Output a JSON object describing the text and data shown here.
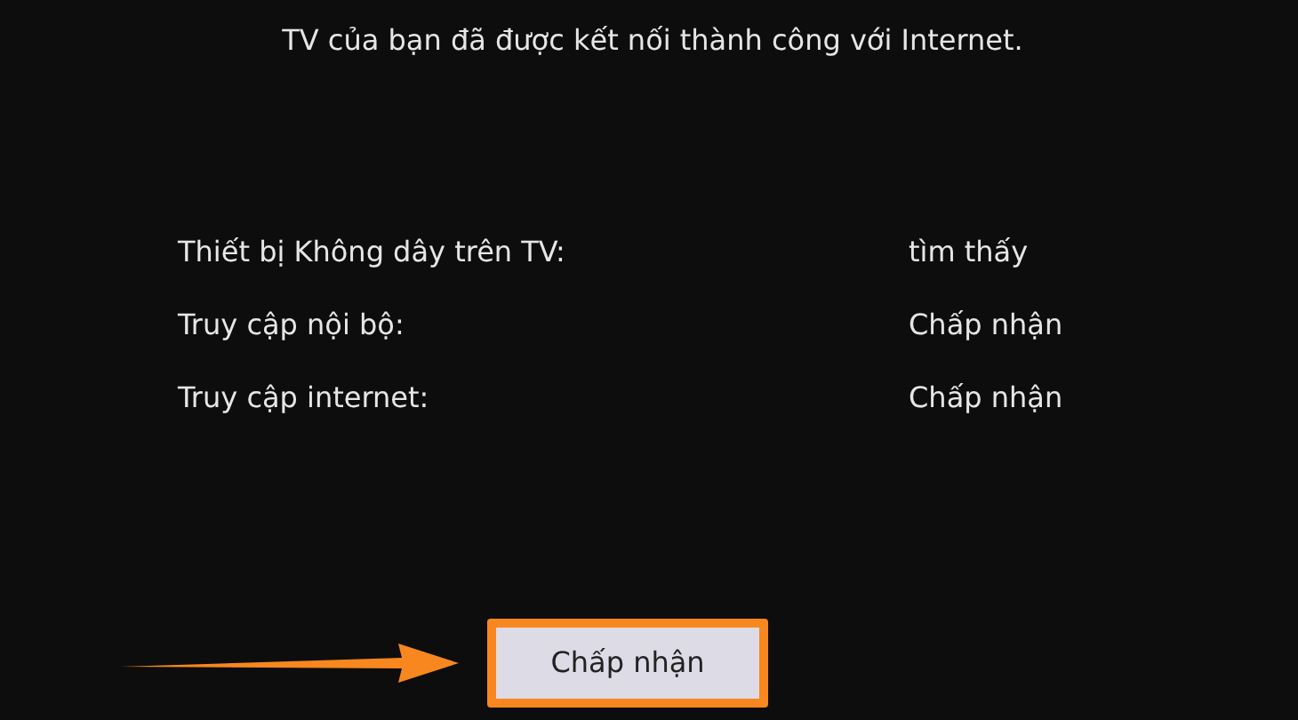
{
  "message": "TV của bạn đã được kết nối thành công với Internet.",
  "status_rows": [
    {
      "label": "Thiết bị Không dây trên TV:",
      "value": "tìm thấy"
    },
    {
      "label": "Truy cập nội bộ:",
      "value": "Chấp nhận"
    },
    {
      "label": "Truy cập internet:",
      "value": "Chấp nhận"
    }
  ],
  "button": {
    "label": "Chấp nhận",
    "highlighted": true
  }
}
